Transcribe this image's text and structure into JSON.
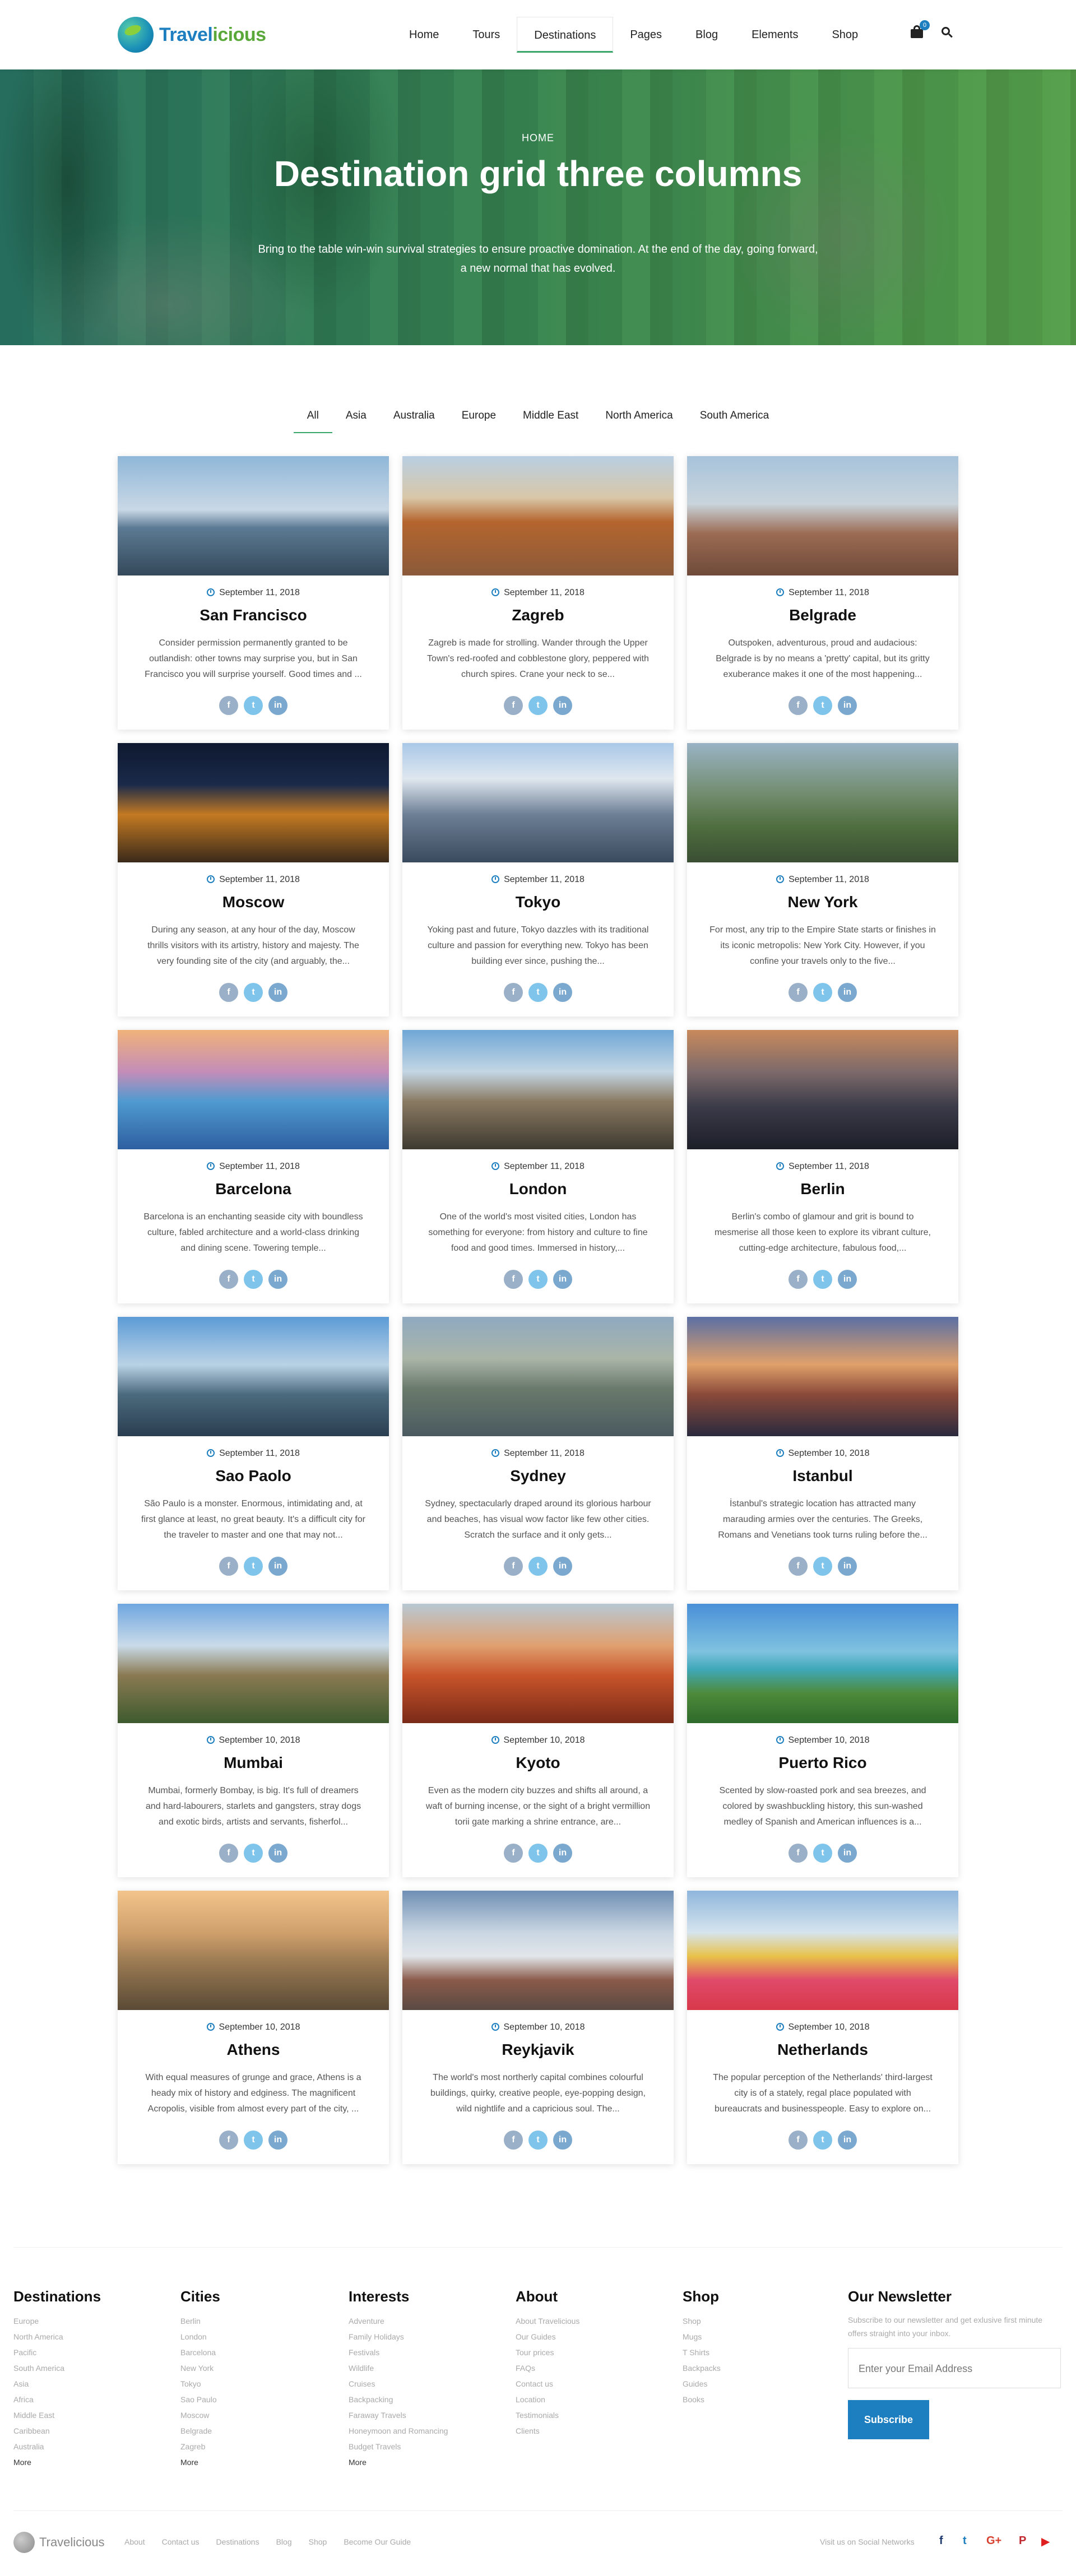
{
  "header": {
    "logo_text_a": "Travel",
    "logo_text_b": "icious",
    "nav": [
      "Home",
      "Tours",
      "Destinations",
      "Pages",
      "Blog",
      "Elements",
      "Shop"
    ],
    "active_nav": "Destinations",
    "cart_count": "0"
  },
  "hero": {
    "breadcrumb": "HOME",
    "title": "Destination grid three columns",
    "subtitle": "Bring to the table win-win survival strategies to ensure proactive domination. At the end of the day, going forward, a new normal that has evolved."
  },
  "filters": [
    "All",
    "Asia",
    "Australia",
    "Europe",
    "Middle East",
    "North America",
    "South America"
  ],
  "active_filter": "All",
  "social_glyphs": {
    "fb": "f",
    "tw": "t",
    "in": "in"
  },
  "cards": [
    {
      "title": "San Francisco",
      "date": "September 11, 2018",
      "text": "Consider permission permanently granted to be outlandish: other towns may surprise you, but in San Francisco you will surprise yourself. Good times and ..."
    },
    {
      "title": "Zagreb",
      "date": "September 11, 2018",
      "text": "Zagreb is made for strolling. Wander through the Upper Town's red-roofed and cobblestone glory, peppered with church spires. Crane your neck to se..."
    },
    {
      "title": "Belgrade",
      "date": "September 11, 2018",
      "text": "Outspoken, adventurous, proud and audacious: Belgrade is by no means a 'pretty' capital, but its gritty exuberance makes it one of the most happening..."
    },
    {
      "title": "Moscow",
      "date": "September 11, 2018",
      "text": "During any season, at any hour of the day, Moscow thrills visitors with its artistry, history and majesty. The very founding site of the city (and arguably, the..."
    },
    {
      "title": "Tokyo",
      "date": "September 11, 2018",
      "text": "Yoking past and future, Tokyo dazzles with its traditional culture and passion for everything new. Tokyo has been building ever since, pushing the..."
    },
    {
      "title": "New York",
      "date": "September 11, 2018",
      "text": "For most, any trip to the Empire State starts or finishes in its iconic metropolis: New York City. However, if you confine your travels only to the five..."
    },
    {
      "title": "Barcelona",
      "date": "September 11, 2018",
      "text": "Barcelona is an enchanting seaside city with boundless culture, fabled architecture and a world-class drinking and dining scene. Towering temple..."
    },
    {
      "title": "London",
      "date": "September 11, 2018",
      "text": "One of the world's most visited cities, London has something for everyone: from history and culture to fine food and good times. Immersed in history,..."
    },
    {
      "title": "Berlin",
      "date": "September 11, 2018",
      "text": "Berlin's combo of glamour and grit is bound to mesmerise all those keen to explore its vibrant culture, cutting-edge architecture, fabulous food,..."
    },
    {
      "title": "Sao Paolo",
      "date": "September 11, 2018",
      "text": "São Paulo is a monster. Enormous, intimidating and, at first glance at least, no great beauty. It's a difficult city for the traveler to master and one that may not..."
    },
    {
      "title": "Sydney",
      "date": "September 11, 2018",
      "text": "Sydney, spectacularly draped around its glorious harbour and beaches, has visual wow factor like few other cities. Scratch the surface and it only gets..."
    },
    {
      "title": "Istanbul",
      "date": "September 10, 2018",
      "text": "İstanbul's strategic location has attracted many marauding armies over the centuries. The Greeks, Romans and Venetians took turns ruling before the..."
    },
    {
      "title": "Mumbai",
      "date": "September 10, 2018",
      "text": "Mumbai, formerly Bombay, is big. It's full of dreamers and hard-labourers, starlets and gangsters, stray dogs and exotic birds, artists and servants, fisherfol..."
    },
    {
      "title": "Kyoto",
      "date": "September 10, 2018",
      "text": "Even as the modern city buzzes and shifts all around, a waft of burning incense, or the sight of a bright vermillion torii gate marking a shrine entrance, are..."
    },
    {
      "title": "Puerto Rico",
      "date": "September 10, 2018",
      "text": "Scented by slow-roasted pork and sea breezes, and colored by swashbuckling history, this sun-washed medley of Spanish and American influences is a..."
    },
    {
      "title": "Athens",
      "date": "September 10, 2018",
      "text": "With equal measures of grunge and grace, Athens is a heady mix of history and edginess. The magnificent Acropolis, visible from almost every part of the city, ..."
    },
    {
      "title": "Reykjavik",
      "date": "September 10, 2018",
      "text": "The world's most northerly capital combines colourful buildings, quirky, creative people, eye-popping design, wild nightlife and a capricious soul. The..."
    },
    {
      "title": "Netherlands",
      "date": "September 10, 2018",
      "text": "The popular perception of the Netherlands' third-largest city is of a stately, regal place populated with bureaucrats and businesspeople. Easy to explore on..."
    }
  ],
  "footer": {
    "columns": [
      {
        "title": "Destinations",
        "links": [
          "Europe",
          "North America",
          "Pacific",
          "South America",
          "Asia",
          "Africa",
          "Middle East",
          "Caribbean",
          "Australia"
        ],
        "more": "More"
      },
      {
        "title": "Cities",
        "links": [
          "Berlin",
          "London",
          "Barcelona",
          "New York",
          "Tokyo",
          "Sao Paulo",
          "Moscow",
          "Belgrade",
          "Zagreb"
        ],
        "more": "More"
      },
      {
        "title": "Interests",
        "links": [
          "Adventure",
          "Family Holidays",
          "Festivals",
          "Wildlife",
          "Cruises",
          "Backpacking",
          "Faraway Travels",
          "Honeymoon and Romancing",
          "Budget Travels"
        ],
        "more": "More"
      },
      {
        "title": "About",
        "links": [
          "About Travelicious",
          "Our Guides",
          "Tour prices",
          "FAQs",
          "Contact us",
          "Location",
          "Testimonials",
          "Clients"
        ],
        "more": ""
      },
      {
        "title": "Shop",
        "links": [
          "Shop",
          "Mugs",
          "T Shirts",
          "Backpacks",
          "Guides",
          "Books"
        ],
        "more": ""
      }
    ],
    "newsletter": {
      "title": "Our Newsletter",
      "text": "Subscribe to our newsletter and get exlusive first minute offers straight into your inbox.",
      "placeholder": "Enter your Email Address",
      "button": "Subscribe"
    },
    "bottom": {
      "logo": "Travelicious",
      "links": [
        "About",
        "Contact us",
        "Destinations",
        "Blog",
        "Shop",
        "Become Our Guide"
      ],
      "social_label": "Visit us on Social Networks",
      "social_glyphs": [
        "f",
        "t",
        "G+",
        "P",
        "▶"
      ]
    }
  },
  "colors": {
    "accent_green": "#3aa66a",
    "brand_blue": "#1e7fc0"
  }
}
